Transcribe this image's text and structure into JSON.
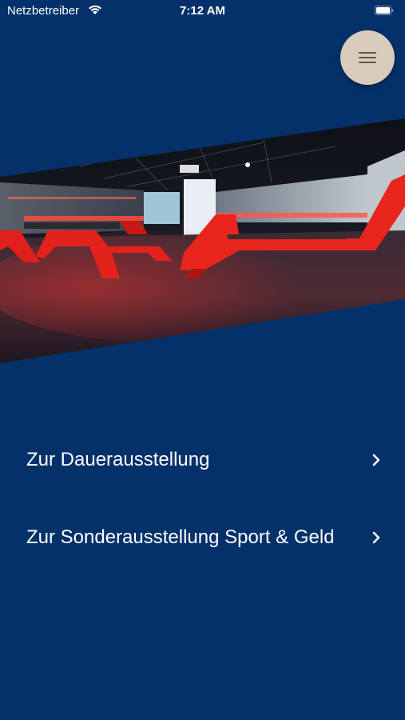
{
  "status_bar": {
    "carrier": "Netzbetreiber",
    "time": "7:12 AM",
    "wifi_icon": "wifi-icon",
    "battery_icon": "battery-icon"
  },
  "header": {
    "menu_icon": "hamburger-menu-icon"
  },
  "hero": {
    "image_description_icon": "exhibition-hall-photo"
  },
  "navigation": {
    "items": [
      {
        "label": "Zur Dauerausstellung",
        "icon": "chevron-right-icon"
      },
      {
        "label": "Zur Sonderausstellung Sport & Geld",
        "icon": "chevron-right-icon"
      }
    ]
  },
  "colors": {
    "background": "#04316a",
    "menu_button": "#d8ccbd",
    "text": "#ffffff",
    "accent_red": "#e0201a"
  }
}
